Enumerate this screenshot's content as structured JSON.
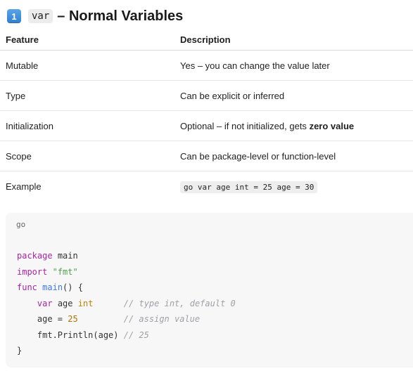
{
  "heading": {
    "emoji_number": "1",
    "code_word": "var",
    "title": "– Normal Variables"
  },
  "table": {
    "headers": [
      "Feature",
      "Description"
    ],
    "rows": [
      {
        "feature": "Mutable",
        "description": "Yes – you can change the value later"
      },
      {
        "feature": "Type",
        "description": "Can be explicit or inferred"
      },
      {
        "feature": "Initialization",
        "description_prefix": "Optional – if not initialized, gets ",
        "description_bold": "zero value"
      },
      {
        "feature": "Scope",
        "description": "Can be package-level or function-level"
      },
      {
        "feature": "Example",
        "description_code": "go var age int = 25 age = 30"
      }
    ]
  },
  "codeblock": {
    "language": "go",
    "tokens": {
      "package_kw": "package",
      "package_name": "main",
      "import_kw": "import",
      "import_path": "\"fmt\"",
      "func_kw": "func",
      "func_name": "main",
      "func_sig": "() {",
      "var_kw": "var",
      "var_name": "age",
      "var_type": "int",
      "comment1": "// type int, default 0",
      "assign_lhs": "age = ",
      "assign_val": "25",
      "comment2": "// assign value",
      "println_call": "fmt.Println(age)",
      "comment3": "// 25",
      "close_brace": "}"
    }
  },
  "colors": {
    "keyword": "#a626a4",
    "function": "#4078f2",
    "string": "#50a14f",
    "type": "#c18401",
    "number": "#b07300",
    "comment": "#a0a1a7",
    "code_bg": "#f7f7f7"
  }
}
